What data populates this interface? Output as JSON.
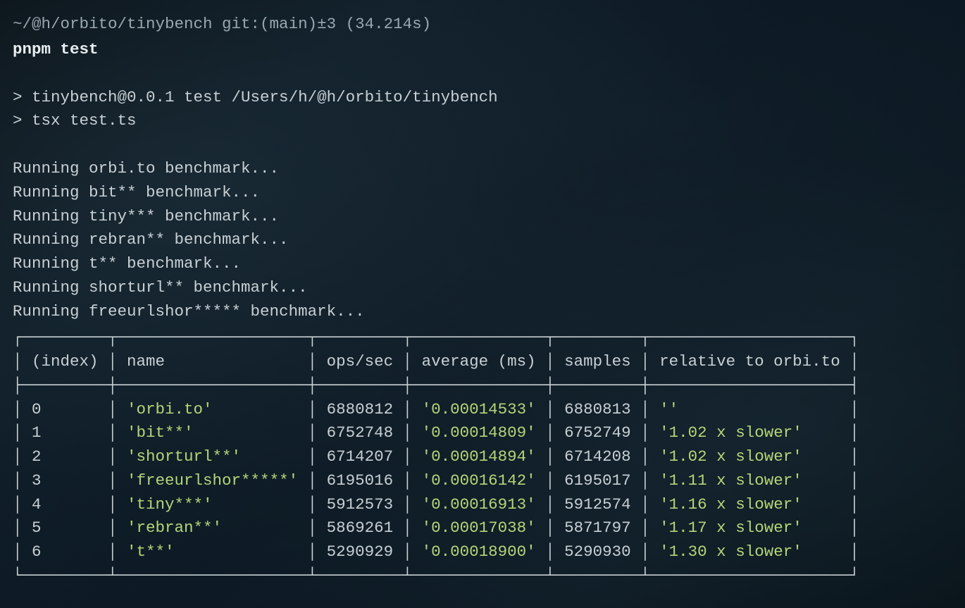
{
  "prompt": "~/@h/orbito/tinybench git:(main)±3 (34.214s)",
  "command": "pnpm test",
  "script_lines": [
    "> tinybench@0.0.1 test /Users/h/@h/orbito/tinybench",
    "> tsx test.ts"
  ],
  "running_lines": [
    "Running orbi.to benchmark...",
    "Running bit** benchmark...",
    "Running tiny*** benchmark...",
    "Running rebran** benchmark...",
    "Running t** benchmark...",
    "Running shorturl** benchmark...",
    "Running freeurlshor***** benchmark..."
  ],
  "table": {
    "headers": [
      "(index)",
      "name",
      "ops/sec",
      "average (ms)",
      "samples",
      "relative to orbi.to"
    ],
    "rows": [
      {
        "index": "0",
        "name": "'orbi.to'",
        "ops": "6880812",
        "avg": "'0.00014533'",
        "samples": "6880813",
        "rel": "''"
      },
      {
        "index": "1",
        "name": "'bit**'",
        "ops": "6752748",
        "avg": "'0.00014809'",
        "samples": "6752749",
        "rel": "'1.02 x slower'"
      },
      {
        "index": "2",
        "name": "'shorturl**'",
        "ops": "6714207",
        "avg": "'0.00014894'",
        "samples": "6714208",
        "rel": "'1.02 x slower'"
      },
      {
        "index": "3",
        "name": "'freeurlshor*****'",
        "ops": "6195016",
        "avg": "'0.00016142'",
        "samples": "6195017",
        "rel": "'1.11 x slower'"
      },
      {
        "index": "4",
        "name": "'tiny***'",
        "ops": "5912573",
        "avg": "'0.00016913'",
        "samples": "5912574",
        "rel": "'1.16 x slower'"
      },
      {
        "index": "5",
        "name": "'rebran**'",
        "ops": "5869261",
        "avg": "'0.00017038'",
        "samples": "5871797",
        "rel": "'1.17 x slower'"
      },
      {
        "index": "6",
        "name": "'t**'",
        "ops": "5290929",
        "avg": "'0.00018900'",
        "samples": "5290930",
        "rel": "'1.30 x slower'"
      }
    ]
  },
  "chart_data": {
    "type": "table",
    "title": "Benchmark results relative to orbi.to",
    "columns": [
      "(index)",
      "name",
      "ops/sec",
      "average (ms)",
      "samples",
      "relative to orbi.to"
    ],
    "rows": [
      [
        0,
        "orbi.to",
        6880812,
        0.00014533,
        6880813,
        ""
      ],
      [
        1,
        "bit**",
        6752748,
        0.00014809,
        6752749,
        "1.02 x slower"
      ],
      [
        2,
        "shorturl**",
        6714207,
        0.00014894,
        6714208,
        "1.02 x slower"
      ],
      [
        3,
        "freeurlshor*****",
        6195016,
        0.00016142,
        6195017,
        "1.11 x slower"
      ],
      [
        4,
        "tiny***",
        5912573,
        0.00016913,
        5912574,
        "1.16 x slower"
      ],
      [
        5,
        "rebran**",
        5869261,
        0.00017038,
        5871797,
        "1.17 x slower"
      ],
      [
        6,
        "t**",
        5290929,
        0.000189,
        5290930,
        "1.30 x slower"
      ]
    ]
  }
}
